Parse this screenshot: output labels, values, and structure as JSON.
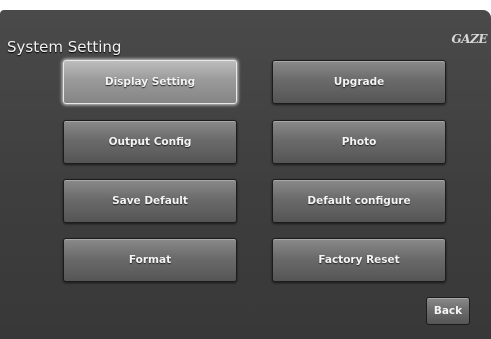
{
  "header": {
    "title": "System Setting",
    "logo_text": "GAZE"
  },
  "buttons": {
    "display_setting": "Display Setting",
    "upgrade": "Upgrade",
    "output_config": "Output Config",
    "photo": "Photo",
    "save_default": "Save Default",
    "default_configure": "Default configure",
    "format": "Format",
    "factory_reset": "Factory Reset",
    "back": "Back"
  },
  "state": {
    "selected_button": "Display Setting"
  }
}
